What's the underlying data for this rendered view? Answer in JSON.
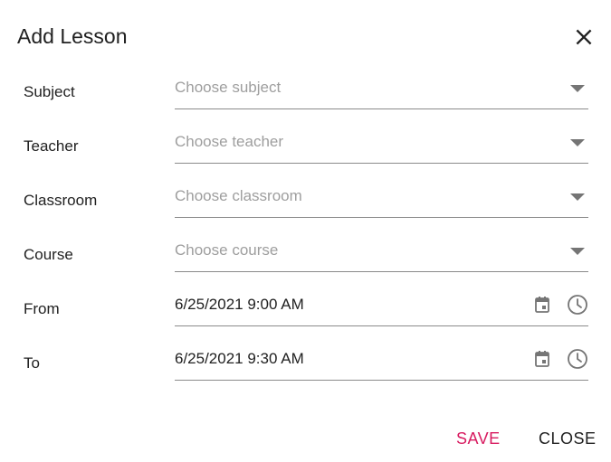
{
  "dialog": {
    "title": "Add Lesson",
    "save_label": "SAVE",
    "close_label": "CLOSE"
  },
  "fields": {
    "subject": {
      "label": "Subject",
      "placeholder": "Choose subject"
    },
    "teacher": {
      "label": "Teacher",
      "placeholder": "Choose teacher"
    },
    "classroom": {
      "label": "Classroom",
      "placeholder": "Choose classroom"
    },
    "course": {
      "label": "Course",
      "placeholder": "Choose course"
    },
    "from": {
      "label": "From",
      "value": "6/25/2021 9:00 AM"
    },
    "to": {
      "label": "To",
      "value": "6/25/2021 9:30 AM"
    }
  },
  "colors": {
    "accent": "#d81b60",
    "text": "#212121",
    "placeholder": "#9e9e9e",
    "icon": "#757575"
  },
  "icons": {
    "close": "close-icon",
    "dropdown": "dropdown-arrow-icon",
    "calendar": "calendar-icon",
    "clock": "clock-icon"
  }
}
